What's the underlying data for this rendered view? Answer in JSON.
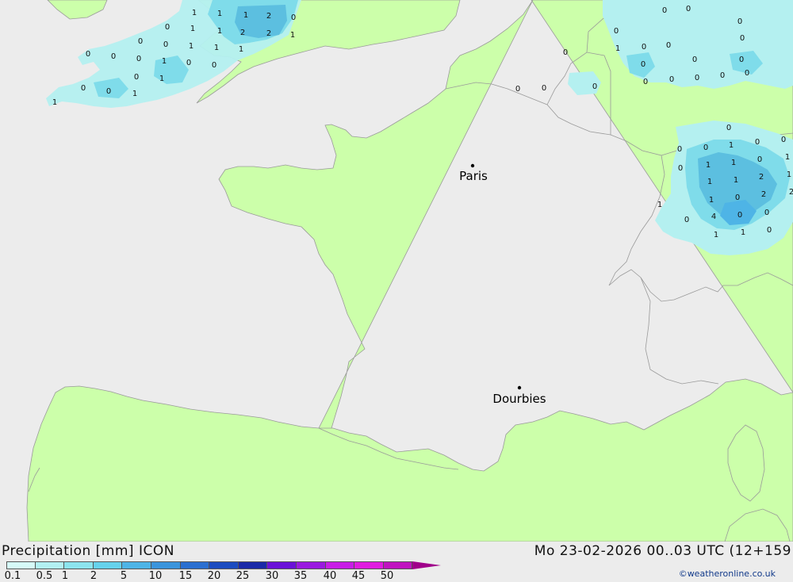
{
  "title": "Precipitation [mm] ICON",
  "run_info": "Mo 23-02-2026 00..03 UTC (12+159",
  "credit": "©weatheronline.co.uk",
  "colors": {
    "sea": "#ececec",
    "land": "#ccffaa",
    "border": "#9a9a9a",
    "precip_light": "#b4f0f0",
    "precip_med": "#7fdcea",
    "precip_heavy": "#5cbfe0"
  },
  "cities": [
    {
      "name": "Paris"
    },
    {
      "name": "Dourbies"
    }
  ],
  "legend": {
    "ticks": [
      "0.1",
      "0.5",
      "1",
      "2",
      "5",
      "10",
      "15",
      "20",
      "25",
      "30",
      "35",
      "40",
      "45",
      "50"
    ],
    "colors": [
      "#d6faf8",
      "#b2f0f2",
      "#8ce4ee",
      "#66d2ec",
      "#4eb4e6",
      "#3b94dc",
      "#2b6fd0",
      "#1c4cc0",
      "#1b2aa8",
      "#6a12d8",
      "#9a1ae0",
      "#c81ee6",
      "#e01ce0",
      "#c014c0"
    ]
  },
  "precip_values": [
    "1",
    "1",
    "1",
    "2",
    "0",
    "0",
    "1",
    "1",
    "2",
    "2",
    "1",
    "0",
    "0",
    "1",
    "1",
    "1",
    "0",
    "0",
    "0",
    "1",
    "0",
    "0",
    "0",
    "1",
    "0",
    "0",
    "1",
    "1",
    "0",
    "0",
    "0",
    "0",
    "0",
    "1",
    "0",
    "0",
    "0",
    "0",
    "0",
    "0",
    "0",
    "0",
    "0",
    "0",
    "0",
    "0",
    "0",
    "0",
    "0",
    "0",
    "0",
    "1",
    "0",
    "0",
    "0",
    "1",
    "1",
    "0",
    "1",
    "1",
    "1",
    "2",
    "1",
    "1",
    "0",
    "2",
    "2",
    "1",
    "0",
    "4",
    "0",
    "0",
    "1",
    "1",
    "0",
    "0",
    "0"
  ]
}
